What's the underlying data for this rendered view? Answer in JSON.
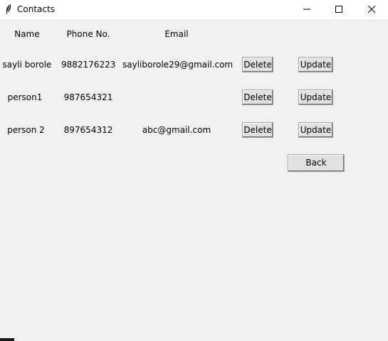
{
  "window": {
    "title": "Contacts",
    "icon": "feather-icon",
    "controls": [
      "minimize-icon",
      "maximize-icon",
      "close-icon"
    ]
  },
  "table": {
    "headers": {
      "name": "Name",
      "phone": "Phone No.",
      "email": "Email"
    },
    "rows": [
      {
        "name": "sayli borole",
        "phone": "9882176223",
        "email": "sayliborole29@gmail.com",
        "delete": "Delete",
        "update": "Update"
      },
      {
        "name": "person1",
        "phone": "987654321",
        "email": "",
        "delete": "Delete",
        "update": "Update"
      },
      {
        "name": "person 2",
        "phone": "897654312",
        "email": "abc@gmail.com",
        "delete": "Delete",
        "update": "Update"
      }
    ]
  },
  "back_label": "Back"
}
